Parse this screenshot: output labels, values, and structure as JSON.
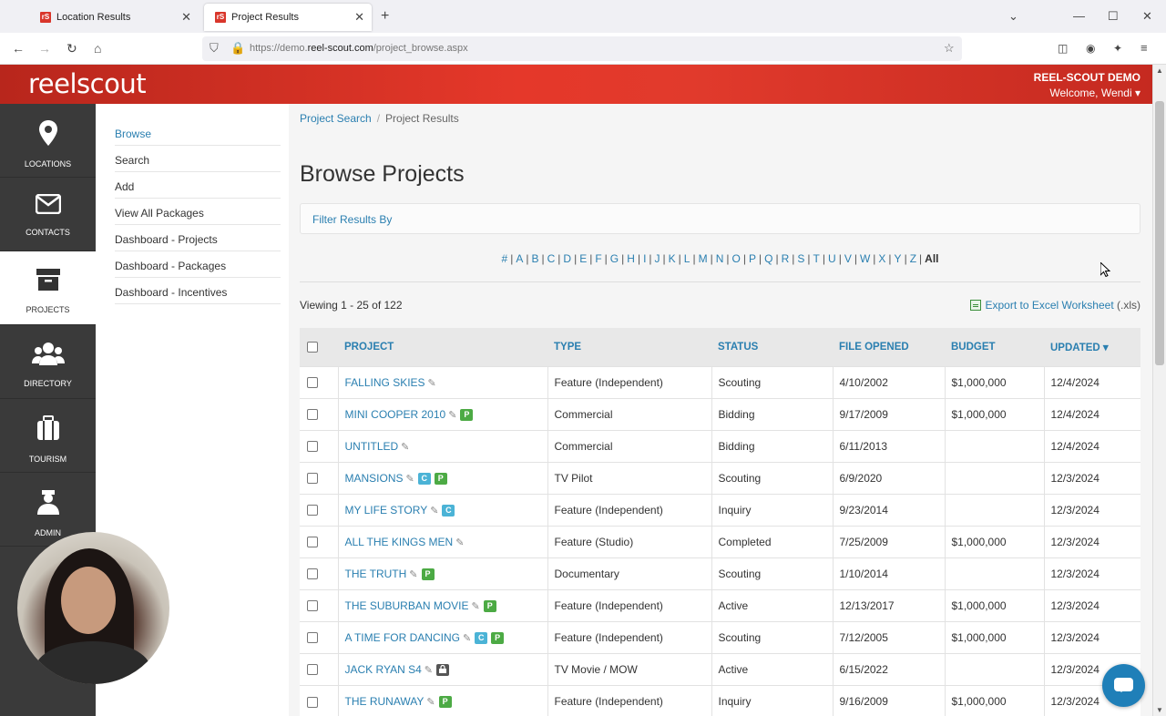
{
  "browser": {
    "tabs": [
      {
        "label": "Location Results",
        "favicon": "rS"
      },
      {
        "label": "Project Results",
        "favicon": "rS"
      }
    ],
    "url_prefix": "https://demo.",
    "url_host": "reel-scout.com",
    "url_path": "/project_browse.aspx"
  },
  "header": {
    "logo": "reelscout",
    "org": "REEL-SCOUT DEMO",
    "welcome": "Welcome, Wendi ▾"
  },
  "sidebar": {
    "items": [
      {
        "label": "LOCATIONS",
        "icon": "map-pin-icon",
        "glyph": "⬤"
      },
      {
        "label": "CONTACTS",
        "icon": "envelope-icon",
        "glyph": "✉"
      },
      {
        "label": "PROJECTS",
        "icon": "archive-box-icon",
        "glyph": "▣"
      },
      {
        "label": "DIRECTORY",
        "icon": "people-icon",
        "glyph": "👥"
      },
      {
        "label": "TOURISM",
        "icon": "suitcase-icon",
        "glyph": "💼"
      },
      {
        "label": "ADMIN",
        "icon": "admin-user-icon",
        "glyph": "👤"
      }
    ]
  },
  "submenu": {
    "items": [
      "Browse",
      "Search",
      "Add",
      "View All Packages",
      "Dashboard - Projects",
      "Dashboard - Packages",
      "Dashboard - Incentives"
    ]
  },
  "main": {
    "breadcrumb": {
      "link": "Project Search",
      "separator": "/",
      "current": "Project Results"
    },
    "title": "Browse Projects",
    "filter_label": "Filter Results By",
    "alphabet": [
      "#",
      "A",
      "B",
      "C",
      "D",
      "E",
      "F",
      "G",
      "H",
      "I",
      "J",
      "K",
      "L",
      "M",
      "N",
      "O",
      "P",
      "Q",
      "R",
      "S",
      "T",
      "U",
      "V",
      "W",
      "X",
      "Y",
      "Z"
    ],
    "alphabet_all": "All",
    "viewing": "Viewing 1 - 25 of 122",
    "export_label": "Export to Excel Worksheet",
    "export_ext": "(.xls)",
    "columns": [
      "PROJECT",
      "TYPE",
      "STATUS",
      "FILE OPENED",
      "BUDGET",
      "UPDATED ▾"
    ],
    "rows": [
      {
        "project": "FALLING SKIES",
        "badges": [],
        "type": "Feature (Independent)",
        "status": "Scouting",
        "opened": "4/10/2002",
        "budget": "$1,000,000",
        "updated": "12/4/2024"
      },
      {
        "project": "MINI COOPER 2010",
        "badges": [
          "P"
        ],
        "type": "Commercial",
        "status": "Bidding",
        "opened": "9/17/2009",
        "budget": "$1,000,000",
        "updated": "12/4/2024"
      },
      {
        "project": "UNTITLED",
        "badges": [],
        "type": "Commercial",
        "status": "Bidding",
        "opened": "6/11/2013",
        "budget": "",
        "updated": "12/4/2024"
      },
      {
        "project": "MANSIONS",
        "badges": [
          "C",
          "P"
        ],
        "type": "TV Pilot",
        "status": "Scouting",
        "opened": "6/9/2020",
        "budget": "",
        "updated": "12/3/2024"
      },
      {
        "project": "MY LIFE STORY",
        "badges": [
          "C"
        ],
        "type": "Feature (Independent)",
        "status": "Inquiry",
        "opened": "9/23/2014",
        "budget": "",
        "updated": "12/3/2024"
      },
      {
        "project": "ALL THE KINGS MEN",
        "badges": [],
        "type": "Feature (Studio)",
        "status": "Completed",
        "opened": "7/25/2009",
        "budget": "$1,000,000",
        "updated": "12/3/2024"
      },
      {
        "project": "THE TRUTH",
        "badges": [
          "P"
        ],
        "type": "Documentary",
        "status": "Scouting",
        "opened": "1/10/2014",
        "budget": "",
        "updated": "12/3/2024"
      },
      {
        "project": "THE SUBURBAN MOVIE",
        "badges": [
          "P"
        ],
        "type": "Feature (Independent)",
        "status": "Active",
        "opened": "12/13/2017",
        "budget": "$1,000,000",
        "updated": "12/3/2024"
      },
      {
        "project": "A TIME FOR DANCING",
        "badges": [
          "C",
          "P"
        ],
        "type": "Feature (Independent)",
        "status": "Scouting",
        "opened": "7/12/2005",
        "budget": "$1,000,000",
        "updated": "12/3/2024"
      },
      {
        "project": "JACK RYAN S4",
        "badges": [
          "LOCK"
        ],
        "type": "TV Movie / MOW",
        "status": "Active",
        "opened": "6/15/2022",
        "budget": "",
        "updated": "12/3/2024"
      },
      {
        "project": "THE RUNAWAY",
        "badges": [
          "P"
        ],
        "type": "Feature (Independent)",
        "status": "Inquiry",
        "opened": "9/16/2009",
        "budget": "$1,000,000",
        "updated": "12/3/2024"
      }
    ]
  },
  "colors": {
    "brand_red": "#e1382a",
    "link_blue": "#2a7fb0",
    "badge_c": "#4bb3d6",
    "badge_p": "#4caa44"
  }
}
